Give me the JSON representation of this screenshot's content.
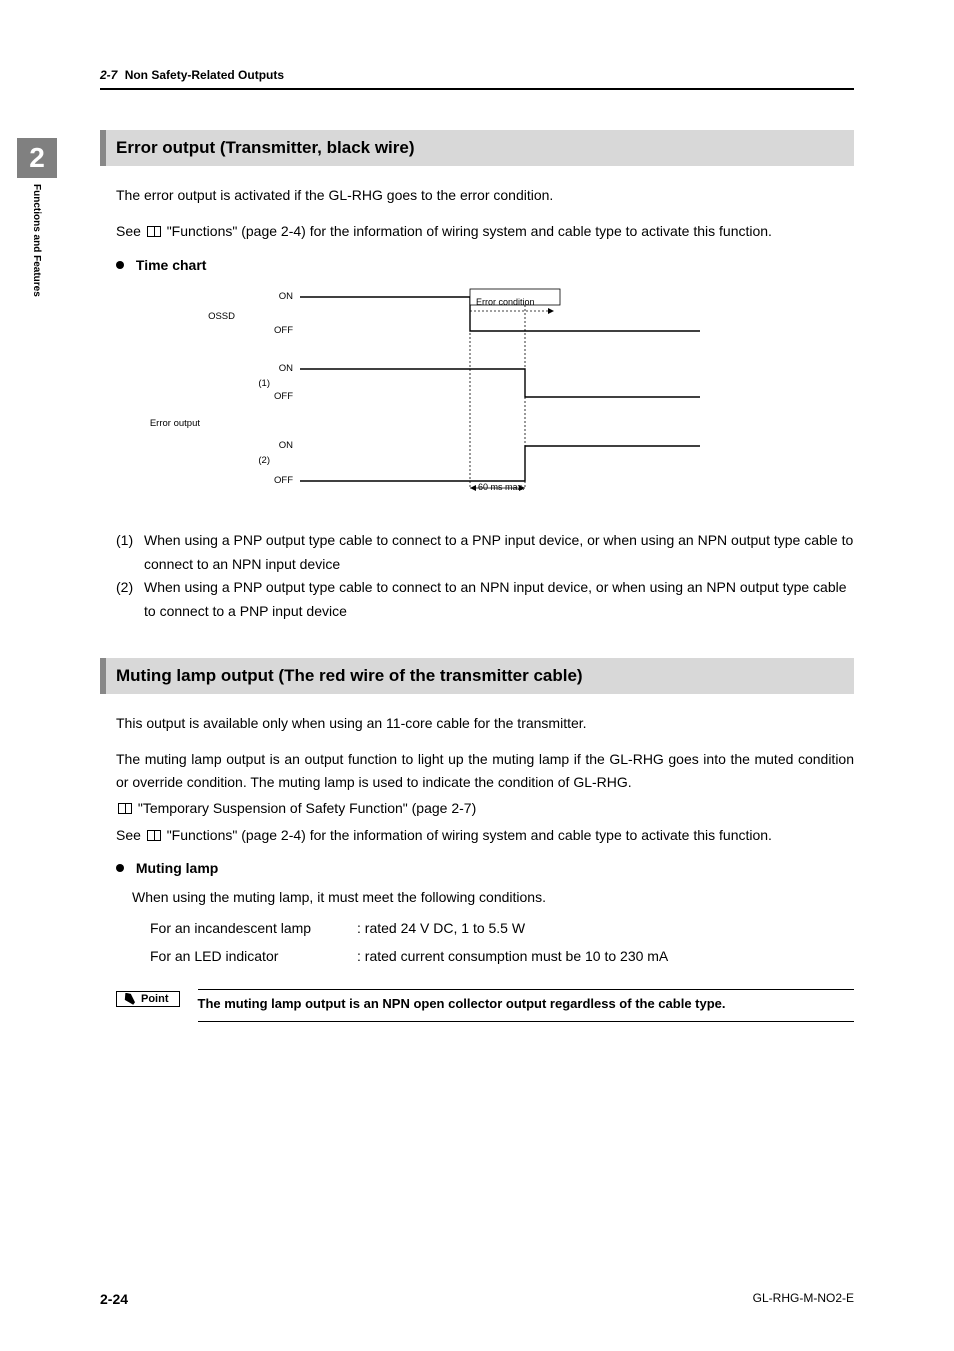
{
  "chapter_number": "2",
  "side_tab_label": "Functions and Features",
  "running_head": {
    "section_number": "2-7",
    "title": "Non Safety-Related Outputs"
  },
  "section1": {
    "heading": "Error output (Transmitter, black wire)",
    "para1": "The error output is activated if the GL-RHG goes to the error condition.",
    "para2_a": "See",
    "para2_b": "\"Functions\" (page 2-4) for the information of wiring system and cable type to activate this function.",
    "sub_heading": "Time chart",
    "chart": {
      "row_label_ossd": "OSSD",
      "row_label_error": "Error output",
      "variant1": "(1)",
      "variant2": "(2)",
      "on": "ON",
      "off": "OFF",
      "annotation_error": "Error condition",
      "annotation_delay": "60 ms max."
    },
    "notes": [
      {
        "tag": "(1)",
        "text": "When using a PNP output type cable to connect to a PNP input device, or when using an NPN output type cable to connect to an NPN input device"
      },
      {
        "tag": "(2)",
        "text": "When using a PNP output type cable to connect to an NPN input device, or when using an NPN output type cable to connect to a PNP input device"
      }
    ]
  },
  "section2": {
    "heading": "Muting lamp output (The red wire of the transmitter cable)",
    "para1": "This output is available only when using an 11-core cable for the transmitter.",
    "para2": "The muting lamp output is an output function to light up the muting lamp if the GL-RHG goes into the muted condition or override condition. The muting lamp is used to indicate the condition of GL-RHG.",
    "ref1": "\"Temporary Suspension of Safety Function\" (page 2-7)",
    "para3_a": "See",
    "para3_b": "\"Functions\" (page 2-4) for the information of wiring system and cable type to activate this function.",
    "sub_heading": "Muting lamp",
    "cond_intro": "When using the muting lamp, it must meet the following conditions.",
    "specs": [
      {
        "label": "For an incandescent lamp",
        "value": ": rated 24 V DC, 1 to 5.5 W"
      },
      {
        "label": "For an LED indicator",
        "value": ": rated current consumption must be 10 to 230 mA"
      }
    ],
    "point_label": "Point",
    "point_text": "The muting lamp output is an NPN open collector output regardless of the cable type."
  },
  "footer": {
    "page": "2-24",
    "doc": "GL-RHG-M-NO2-E"
  }
}
